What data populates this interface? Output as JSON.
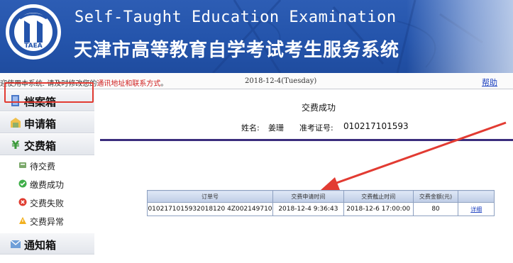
{
  "banner": {
    "logo_text": "TAEA",
    "title_en": "Self-Taught Education Examination",
    "title_cn": "天津市高等教育自学考试考生服务系统"
  },
  "infobar": {
    "notice_prefix": "迎使用本系统. 请及时修改您的",
    "notice_link": "通讯地址和联系方式",
    "notice_suffix": "。",
    "date": "2018-12-4(Tuesday)",
    "help": "帮助"
  },
  "sidebar": {
    "items": [
      {
        "label": "档案箱",
        "icon": "archive-icon"
      },
      {
        "label": "申请箱",
        "icon": "application-icon"
      },
      {
        "label": "交费箱",
        "icon": "yen-icon"
      },
      {
        "label": "待交费",
        "icon": "pending-payment-icon"
      },
      {
        "label": "缴费成功",
        "icon": "check-icon"
      },
      {
        "label": "交费失败",
        "icon": "fail-icon"
      },
      {
        "label": "交费异常",
        "icon": "warning-icon"
      },
      {
        "label": "通知箱",
        "icon": "mail-icon"
      }
    ]
  },
  "content": {
    "title": "交费成功",
    "name_label": "姓名:",
    "name": "姜珊",
    "ticket_label": "准考证号:",
    "ticket": "010217101593"
  },
  "table": {
    "headers": [
      "订单号",
      "交费申请时间",
      "交费截止时间",
      "交费金额(元)",
      ""
    ],
    "rows": [
      [
        "0102171015932018120 4Z002149710",
        "2018-12-4 9:36:43",
        "2018-12-6 17:00:00",
        "80",
        "详细"
      ]
    ]
  },
  "colors": {
    "banner": "#2454ab",
    "highlight": "#e23b32",
    "divider": "#3b2d7d",
    "link": "#1a3fc0"
  }
}
